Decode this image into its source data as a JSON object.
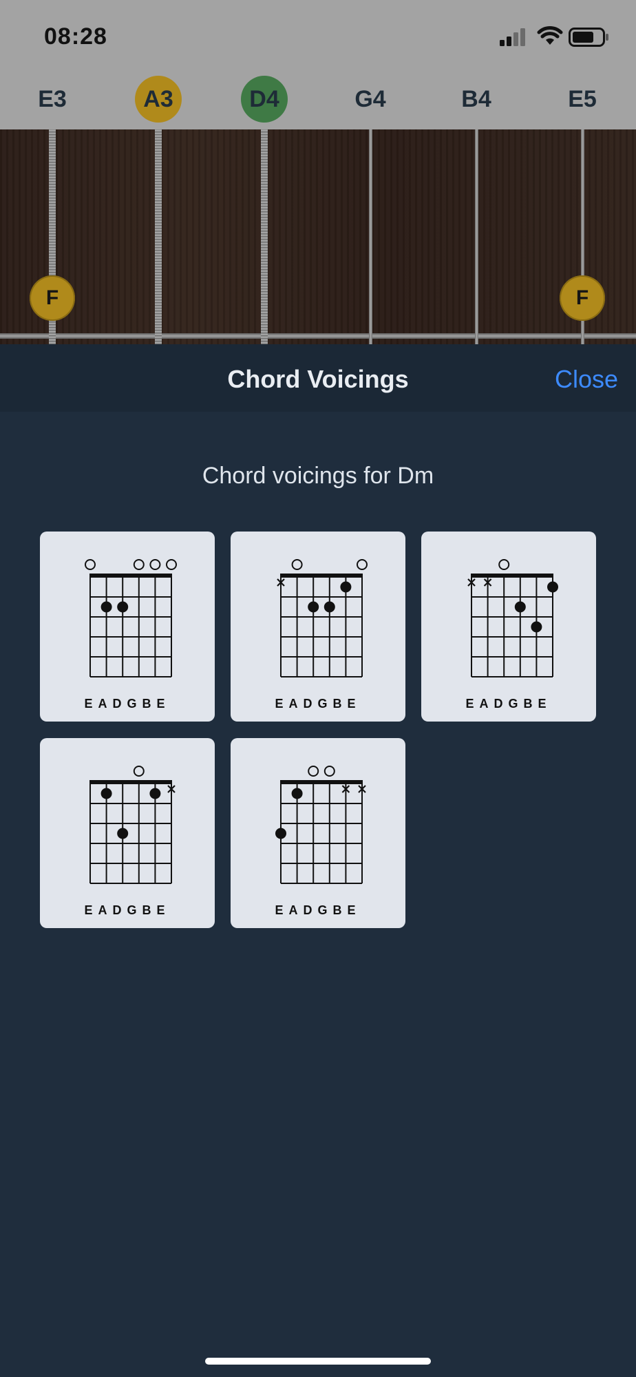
{
  "status_bar": {
    "time": "08:28"
  },
  "strings": [
    {
      "label": "E3",
      "highlight": ""
    },
    {
      "label": "A3",
      "highlight": "#b08a1b"
    },
    {
      "label": "D4",
      "highlight": "#3f7a45"
    },
    {
      "label": "G4",
      "highlight": ""
    },
    {
      "label": "B4",
      "highlight": ""
    },
    {
      "label": "E5",
      "highlight": ""
    }
  ],
  "fret_markers": [
    {
      "string": 1,
      "note": "F"
    },
    {
      "string": 6,
      "note": "F"
    }
  ],
  "modal": {
    "title": "Chord Voicings",
    "close_label": "Close",
    "subtitle": "Chord voicings for Dm"
  },
  "string_names": "EADGBE",
  "voicings": [
    {
      "open": [
        1,
        4,
        5,
        6
      ],
      "muted": [],
      "dots": [
        [
          2,
          2
        ],
        [
          3,
          2
        ]
      ]
    },
    {
      "open": [
        2,
        6
      ],
      "muted": [
        1
      ],
      "dots": [
        [
          3,
          2
        ],
        [
          4,
          2
        ],
        [
          5,
          1
        ]
      ]
    },
    {
      "open": [
        3
      ],
      "muted": [
        1,
        2
      ],
      "dots": [
        [
          4,
          2
        ],
        [
          5,
          3
        ],
        [
          6,
          1
        ]
      ]
    },
    {
      "open": [
        4
      ],
      "muted": [
        6
      ],
      "dots": [
        [
          2,
          1
        ],
        [
          3,
          3
        ],
        [
          5,
          1
        ]
      ]
    },
    {
      "open": [
        3,
        4
      ],
      "muted": [
        5,
        6
      ],
      "dots": [
        [
          1,
          3
        ],
        [
          2,
          1
        ]
      ]
    }
  ],
  "colors": {
    "accent": "#3d8bff",
    "background": "#1f2d3d",
    "card": "#e1e5ec"
  }
}
